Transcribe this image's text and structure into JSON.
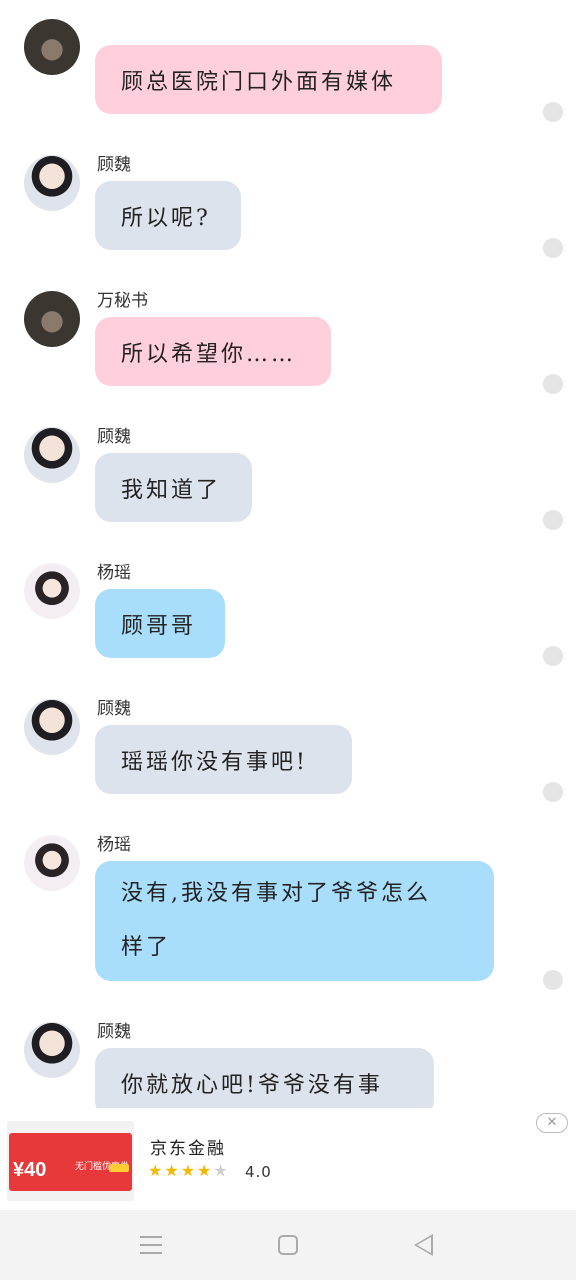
{
  "messages": [
    {
      "sender": "",
      "avatar": "wan-avatar",
      "text": "顾总医院门口外面有媒体",
      "color": "pink"
    },
    {
      "sender": "顾魏",
      "avatar": "gu-avatar",
      "text": "所以呢?",
      "color": "gray"
    },
    {
      "sender": "万秘书",
      "avatar": "wan-avatar",
      "text": "所以希望你……",
      "color": "pink"
    },
    {
      "sender": "顾魏",
      "avatar": "gu-avatar",
      "text": "我知道了",
      "color": "gray"
    },
    {
      "sender": "杨瑶",
      "avatar": "yang-avatar",
      "text": "顾哥哥",
      "color": "blue"
    },
    {
      "sender": "顾魏",
      "avatar": "gu-avatar",
      "text": "瑶瑶你没有事吧!",
      "color": "gray"
    },
    {
      "sender": "杨瑶",
      "avatar": "yang-avatar",
      "text_line1": "没有,我没有事对了爷爷怎么",
      "text_line2": "样了",
      "color": "blue"
    },
    {
      "sender": "顾魏",
      "avatar": "gu-avatar",
      "text": "你就放心吧!爷爷没有事",
      "color": "gray"
    }
  ],
  "ad": {
    "price": "¥40",
    "coupon_text": "无门槛优惠券",
    "title": "京东金融",
    "rating": "4.0",
    "stars_filled": 4,
    "stars_total": 5,
    "close_icon": "close-icon"
  },
  "colors": {
    "pink_bubble": "#ffd0dc",
    "gray_bubble": "#dde3ec",
    "blue_bubble": "#a8defc"
  }
}
